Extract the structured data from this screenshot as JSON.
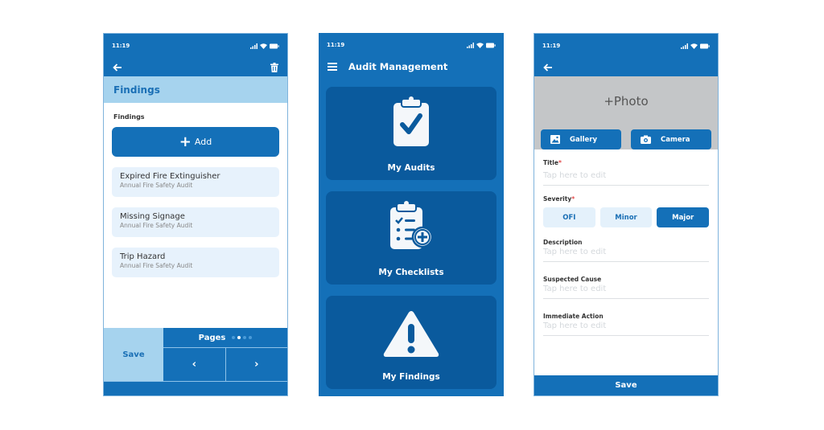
{
  "colors": {
    "primary": "#1470b8",
    "light": "#a6d3ee",
    "tile": "#0a5a9d",
    "required": "#e24b4b"
  },
  "status_bar": {
    "time": "11:19",
    "icons": [
      "signal-icon",
      "wifi-icon",
      "battery-icon"
    ]
  },
  "findings_screen": {
    "header_title": "Findings",
    "section_label": "Findings",
    "add_label": "Add",
    "items": [
      {
        "title": "Expired Fire Extinguisher",
        "subtitle": "Annual Fire Safety Audit"
      },
      {
        "title": "Missing Signage",
        "subtitle": "Annual Fire Safety Audit"
      },
      {
        "title": "Trip Hazard",
        "subtitle": "Annual Fire Safety Audit"
      }
    ],
    "save_label": "Save",
    "pages_label": "Pages",
    "current_page": 2,
    "total_pages": 4,
    "prev_label": "‹",
    "next_label": "›"
  },
  "home_screen": {
    "title": "Audit Management",
    "tiles": [
      {
        "label": "My Audits",
        "icon": "clipboard-check-icon"
      },
      {
        "label": "My Checklists",
        "icon": "checklist-add-icon"
      },
      {
        "label": "My Findings",
        "icon": "warning-icon"
      }
    ]
  },
  "new_finding_screen": {
    "photo_label": "+Photo",
    "gallery_label": "Gallery",
    "camera_label": "Camera",
    "fields": {
      "title": {
        "label": "Title",
        "required": "*",
        "placeholder": "Tap here to edit"
      },
      "severity": {
        "label": "Severity",
        "required": "*",
        "options": [
          "OFI",
          "Minor",
          "Major"
        ],
        "selected": "Major"
      },
      "description": {
        "label": "Description",
        "placeholder": "Tap here to edit"
      },
      "suspected_cause": {
        "label": "Suspected Cause",
        "placeholder": "Tap here to edit"
      },
      "immediate_action": {
        "label": "Immediate Action",
        "placeholder": "Tap here to edit"
      }
    },
    "save_label": "Save"
  }
}
